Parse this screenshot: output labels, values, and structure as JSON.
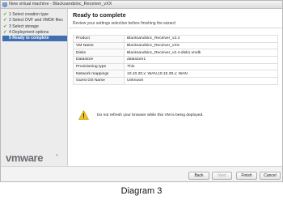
{
  "window": {
    "title": "New virtual machine - Blacksandsinc_Receiver_vXX"
  },
  "sidebar": {
    "steps": [
      {
        "label": "1 Select creation type",
        "done": true
      },
      {
        "label": "2 Select OVF and VMDK files",
        "done": true
      },
      {
        "label": "3 Select storage",
        "done": true
      },
      {
        "label": "4 Deployment options",
        "done": true
      },
      {
        "label": "5 Ready to complete",
        "done": false,
        "active": true
      }
    ],
    "check_glyph": "✔",
    "logo_text": "vmware",
    "logo_mark": "®"
  },
  "main": {
    "title": "Ready to complete",
    "subtitle": "Review your settings selection before finishing the wizard",
    "summary": [
      {
        "label": "Product",
        "value": "Blacksandsinc_Receiver_v2.4"
      },
      {
        "label": "VM Name",
        "value": "Blacksandsinc_Receiver_vXX"
      },
      {
        "label": "Disks",
        "value": "Blacksandsinc_Receiver_v2.4-disk1.vmdk"
      },
      {
        "label": "Datastore",
        "value": "datastore1"
      },
      {
        "label": "Provisioning type",
        "value": "Thin"
      },
      {
        "label": "Network mappings",
        "value": "10.10.20.x: WAN,10.10.30.x: WAN"
      },
      {
        "label": "Guest OS Name",
        "value": "Unknown"
      }
    ],
    "warning": {
      "icon": "warning-icon",
      "text": "Do not refresh your browser while this VM is being deployed."
    }
  },
  "footer": {
    "back_label": "Back",
    "next_label": "Next",
    "finish_label": "Finish",
    "cancel_label": "Cancel"
  },
  "caption": "Diagram 3",
  "colors": {
    "active_step": "#3f6fb0",
    "check": "#5c9a2b",
    "warning_fill": "#f2c319",
    "logo": "#6a6e73"
  }
}
